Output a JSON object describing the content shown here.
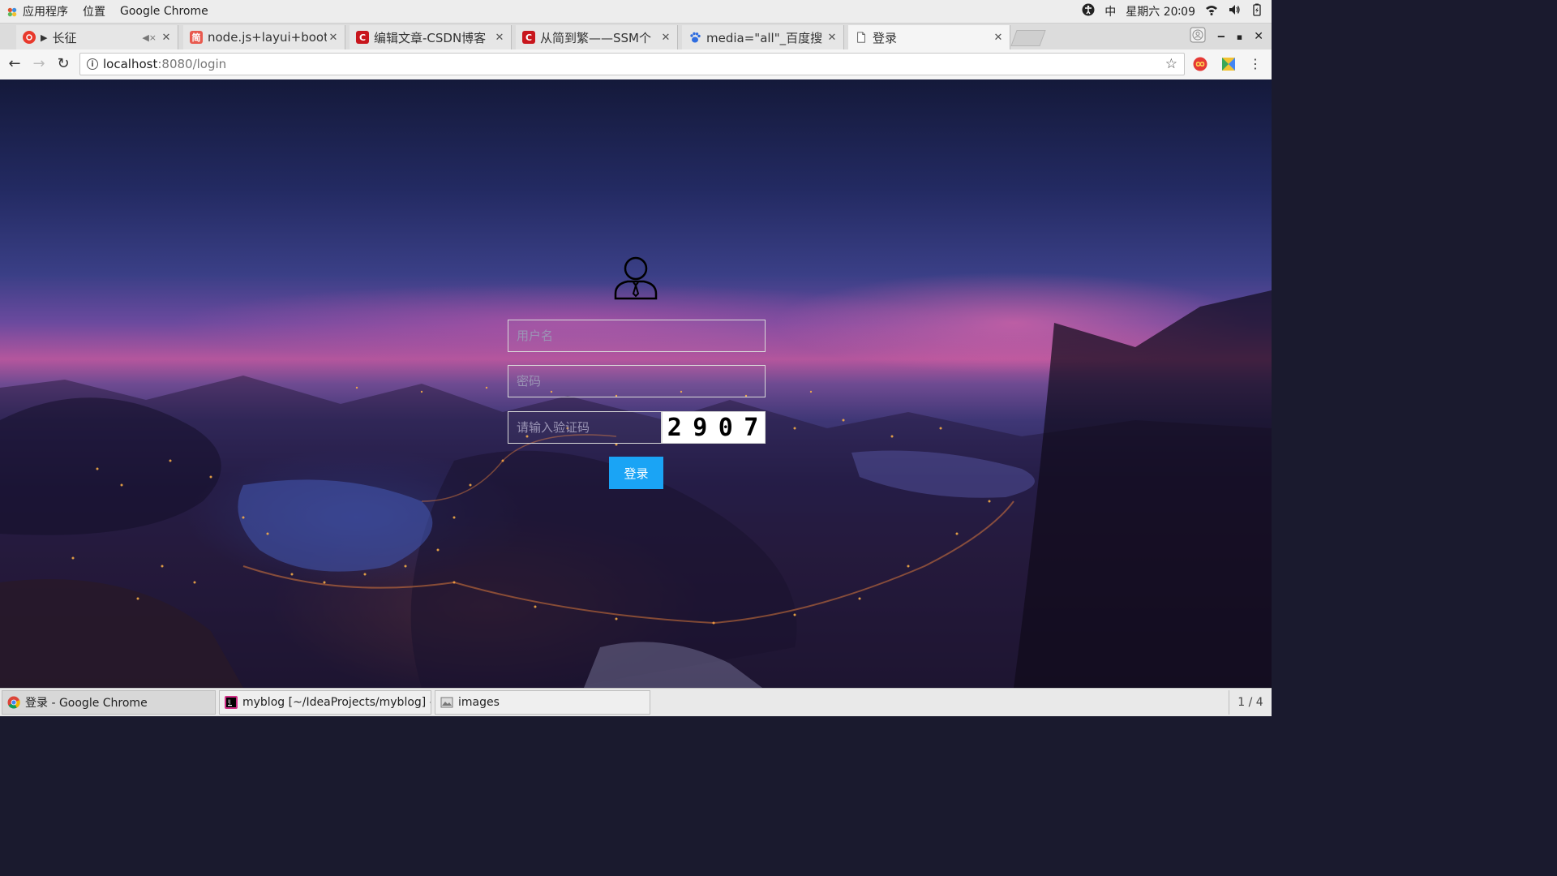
{
  "topbar": {
    "menu_apps": "应用程序",
    "menu_places": "位置",
    "menu_app": "Google Chrome",
    "input_method": "中",
    "clock": "星期六 20∶09"
  },
  "tabs": [
    {
      "title": "长征",
      "favicon_color": "#e8392c",
      "favicon_text": "",
      "muted_icon": true
    },
    {
      "title": "node.js+layui+boots",
      "favicon_color": "#e85a4f",
      "favicon_text": "简"
    },
    {
      "title": "编辑文章-CSDN博客",
      "favicon_color": "#c8161d",
      "favicon_text": "C"
    },
    {
      "title": "从简到繁——SSM个",
      "favicon_color": "#c8161d",
      "favicon_text": "C"
    },
    {
      "title": "media=\"all\"_百度搜",
      "favicon_color": "#2f6de0",
      "favicon_text": ""
    },
    {
      "title": "登录",
      "favicon_color": "",
      "favicon_text": ""
    }
  ],
  "address": {
    "host": "localhost",
    "path": ":8080/login"
  },
  "login": {
    "username_placeholder": "用户名",
    "password_placeholder": "密码",
    "captcha_placeholder": "请输入验证码",
    "captcha_digits": [
      "2",
      "9",
      "0",
      "7"
    ],
    "submit_label": "登录",
    "button_color": "#1aa4f5"
  },
  "taskbar": {
    "items": [
      {
        "label": "登录 - Google Chrome",
        "icon": "chrome-icon"
      },
      {
        "label": "myblog [~/IdeaProjects/myblog] - .../…",
        "icon": "intellij-icon"
      },
      {
        "label": "images",
        "icon": "image-viewer-icon"
      }
    ],
    "workspace": "1 / 4"
  }
}
